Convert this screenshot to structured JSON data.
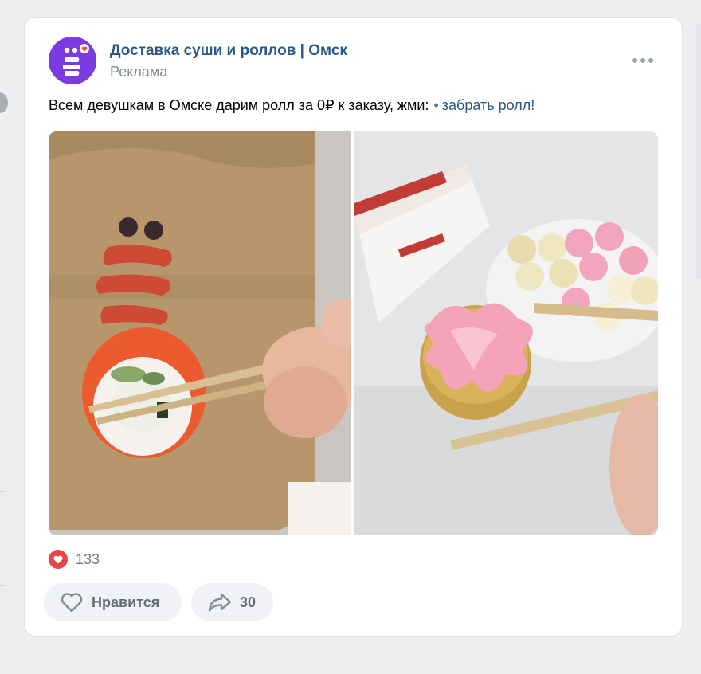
{
  "post": {
    "author": "Доставка суши и роллов | Омск",
    "sponsored_label": "Реклама",
    "text": "Всем девушкам в Омске дарим ролл за 0₽ к заказу, жми:",
    "link_text": "забрать ролл!",
    "link_separator": "•",
    "images": [
      {
        "icon": "sushi-roll-on-chopsticks-photo"
      },
      {
        "icon": "baked-roll-on-chopsticks-photo"
      }
    ]
  },
  "reactions": {
    "icon": "heart-icon",
    "count": "133"
  },
  "actions": {
    "like_label": "Нравится",
    "share_count": "30"
  },
  "colors": {
    "author": "#2a5885",
    "avatar": "#7b3be0",
    "heart": "#e64646"
  }
}
